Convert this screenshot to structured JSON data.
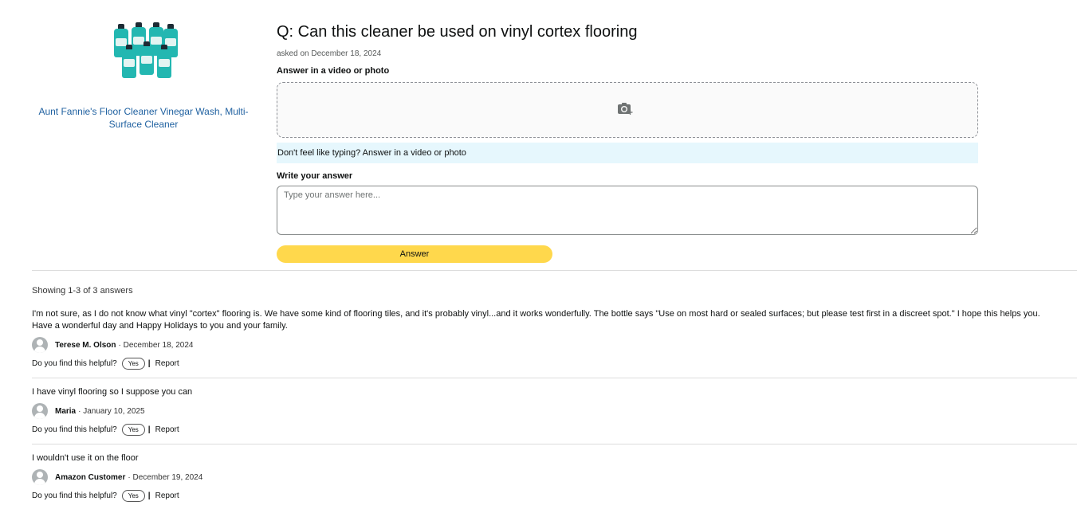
{
  "product": {
    "name": "Aunt Fannie's Floor Cleaner Vinegar Wash, Multi-Surface Cleaner",
    "image_icon": "product-bottles-image"
  },
  "question": {
    "title": "Q: Can this cleaner be used on vinyl cortex flooring",
    "asked_on": "asked on December 18, 2024"
  },
  "answer_form": {
    "media_label": "Answer in a video or photo",
    "upload_icon": "camera-plus-icon",
    "hint": "Don't feel like typing? Answer in a video or photo",
    "write_label": "Write your answer",
    "placeholder": "Type your answer here...",
    "submit_label": "Answer",
    "submit_color": "#ffd84c"
  },
  "answers_summary": "Showing 1-3 of 3 answers",
  "helpful_prompt": "Do you find this helpful?",
  "yes_label": "Yes",
  "separator": "|",
  "report_label": "Report",
  "answers": [
    {
      "text": "I'm not sure, as I do not know what vinyl \"cortex\" flooring is. We have some kind of flooring tiles, and it's probably vinyl...and it works wonderfully. The bottle says \"Use on most hard or sealed surfaces; but please test first in a discreet spot.\" I hope this helps you. Have a wonderful day and Happy Holidays to you and your family.",
      "author": "Terese M. Olson",
      "date": "· December 18, 2024"
    },
    {
      "text": "I have vinyl flooring so I suppose you can",
      "author": "Maria",
      "date": "· January 10, 2025"
    },
    {
      "text": "I wouldn't use it on the floor",
      "author": "Amazon Customer",
      "date": "· December 19, 2024"
    }
  ]
}
